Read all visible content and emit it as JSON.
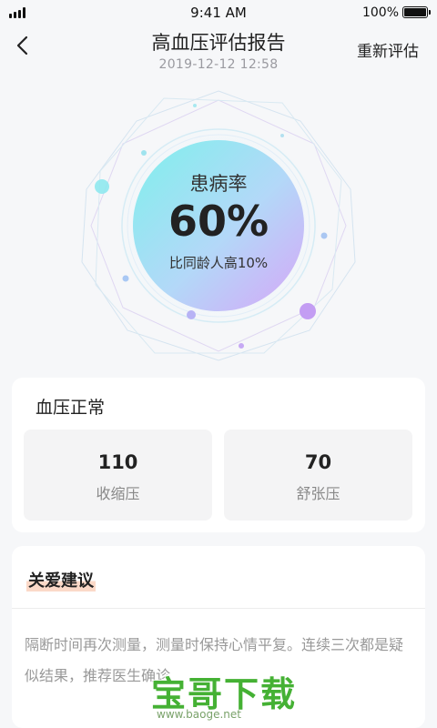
{
  "status_bar": {
    "time": "9:41 AM",
    "battery_percent": "100%"
  },
  "nav": {
    "title": "高血压评估报告",
    "date": "2019-12-12   12:58",
    "action_label": "重新评估",
    "back_icon": "chevron-left-icon"
  },
  "hero": {
    "label": "患病率",
    "value": "60%",
    "comparison": "比同龄人高10%"
  },
  "blood_pressure": {
    "title": "血压正常",
    "systolic_value": "110",
    "systolic_label": "收缩压",
    "diastolic_value": "70",
    "diastolic_label": "舒张压"
  },
  "advice": {
    "title": "关爱建议",
    "text": "隔断时间再次测量，测量时保持心情平复。连续三次都是疑似结果，推荐医生确诊"
  },
  "watermark": {
    "text": "宝哥下载",
    "url": "www.baoge.net"
  },
  "colors": {
    "accent_cyan": "#8be9f0",
    "accent_purple": "#c9a3f6",
    "highlight": "#fbd9c8",
    "watermark_green": "#45b134"
  }
}
